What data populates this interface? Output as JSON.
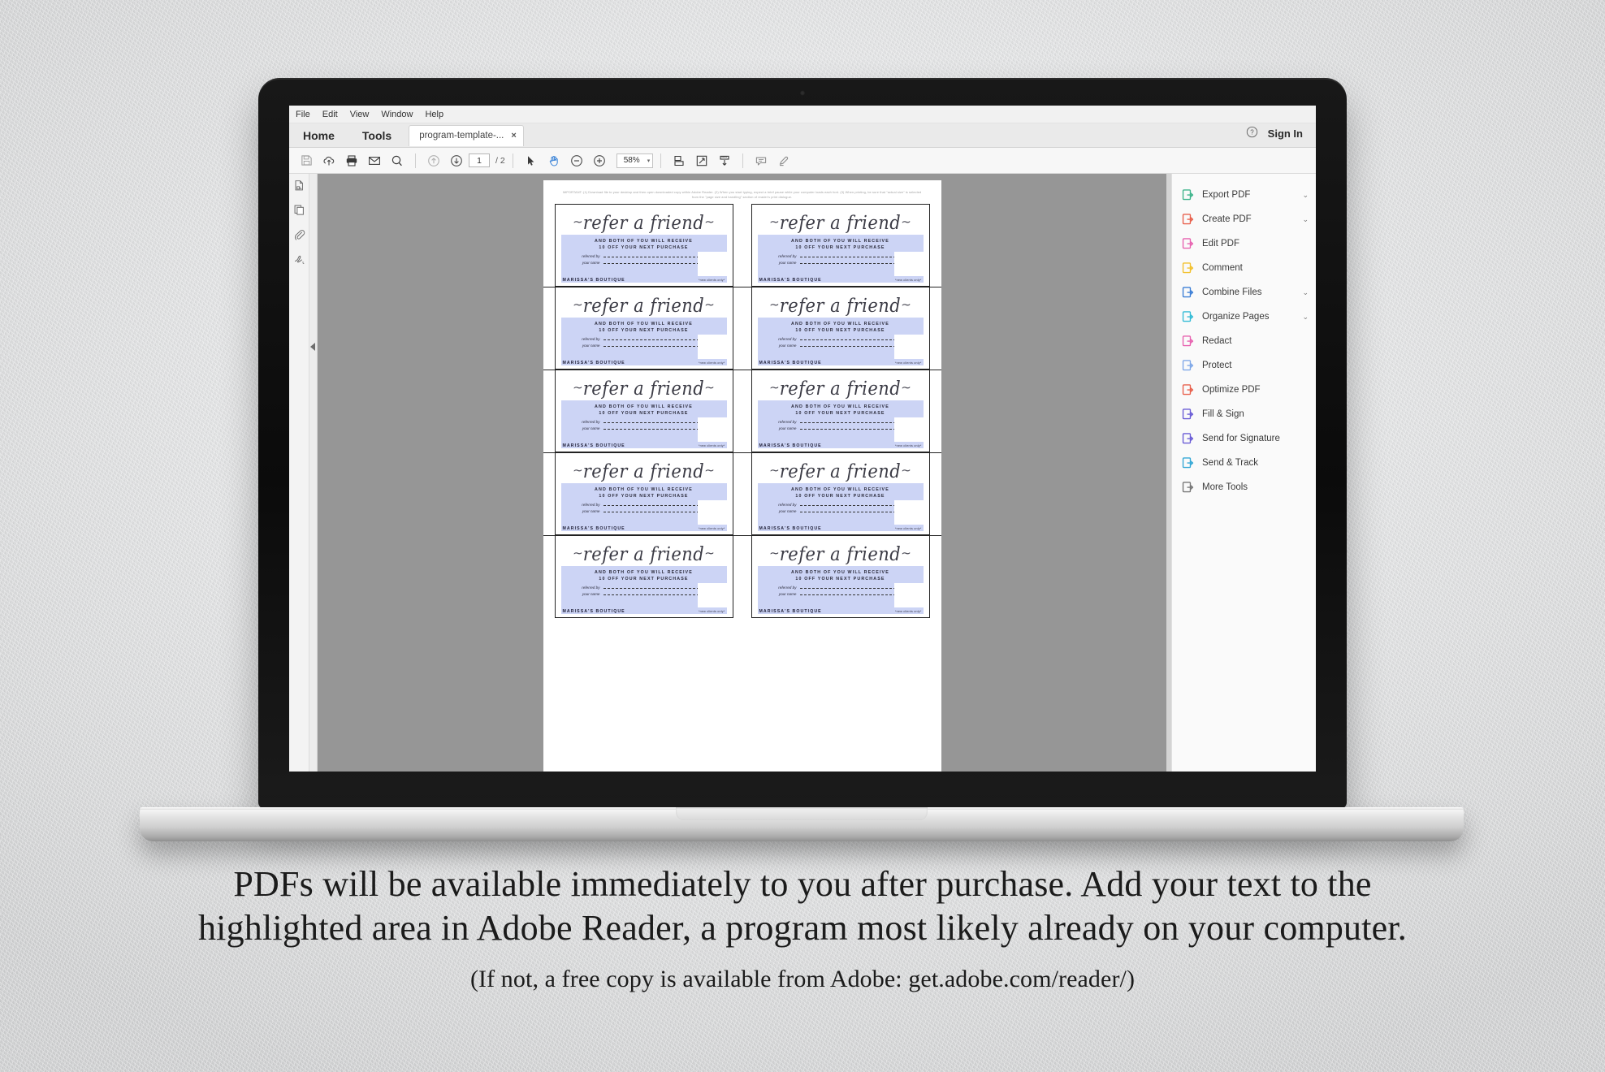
{
  "app": {
    "menubar": [
      "File",
      "Edit",
      "View",
      "Window",
      "Help"
    ],
    "home_label": "Home",
    "tools_label": "Tools",
    "doc_tab_title": "program-template-...",
    "doc_tab_close": "×",
    "help_icon": "help-circle-icon",
    "sign_in_label": "Sign In"
  },
  "toolbar": {
    "icons_left": [
      "save-icon",
      "upload-cloud-icon",
      "print-icon",
      "email-icon",
      "search-icon"
    ],
    "nav_icons": [
      "page-up-icon",
      "page-down-icon"
    ],
    "page_current": "1",
    "page_total": "/ 2",
    "cursor_icons": [
      "select-tool-icon",
      "hand-tool-icon"
    ],
    "zoom_out_icon": "zoom-out-icon",
    "zoom_in_icon": "zoom-in-icon",
    "zoom_value": "58%",
    "zoom_caret": "▾",
    "view_icons": [
      "fit-page-icon",
      "fit-width-icon",
      "scroll-mode-icon"
    ],
    "annot_icons": [
      "comment-icon",
      "highlighter-icon"
    ]
  },
  "left_rail": {
    "items": [
      {
        "icon": "page-thumbnails-icon"
      },
      {
        "icon": "pages-copy-icon"
      },
      {
        "icon": "attachments-paperclip-icon"
      },
      {
        "icon": "signature-icon"
      }
    ],
    "collapse_icon": "collapse-left-arrow-icon"
  },
  "right_panel": {
    "tools": [
      {
        "label": "Export PDF",
        "icon": "export-pdf-icon",
        "color": "#3eb48c",
        "caret": "⌄"
      },
      {
        "label": "Create PDF",
        "icon": "create-pdf-icon",
        "color": "#e8614d",
        "caret": "⌄"
      },
      {
        "label": "Edit PDF",
        "icon": "edit-pdf-icon",
        "color": "#e763b0",
        "caret": ""
      },
      {
        "label": "Comment",
        "icon": "comment-icon",
        "color": "#f2c12e",
        "caret": ""
      },
      {
        "label": "Combine Files",
        "icon": "combine-files-icon",
        "color": "#3d7fd6",
        "caret": "⌄"
      },
      {
        "label": "Organize Pages",
        "icon": "organize-pages-icon",
        "color": "#34bcd6",
        "caret": "⌄"
      },
      {
        "label": "Redact",
        "icon": "redact-icon",
        "color": "#e763b0",
        "caret": ""
      },
      {
        "label": "Protect",
        "icon": "protect-shield-icon",
        "color": "#7fa8e8",
        "caret": ""
      },
      {
        "label": "Optimize PDF",
        "icon": "optimize-pdf-icon",
        "color": "#e8614d",
        "caret": ""
      },
      {
        "label": "Fill & Sign",
        "icon": "fill-and-sign-icon",
        "color": "#6a5cd6",
        "caret": ""
      },
      {
        "label": "Send for Signature",
        "icon": "send-for-signature-icon",
        "color": "#6a5cd6",
        "caret": ""
      },
      {
        "label": "Send & Track",
        "icon": "send-and-track-icon",
        "color": "#34a8d6",
        "caret": ""
      },
      {
        "label": "More Tools",
        "icon": "more-tools-plus-icon",
        "color": "#777777",
        "caret": ""
      }
    ]
  },
  "document": {
    "note": "IMPORTANT: (1) Download file to your desktop and then open downloaded copy within Adobe Reader. (2) When you start typing, expect a brief pause while your computer loads each font. (3) When printing, be sure that \"actual size\" is selected from the \"page size and handling\" section of reader's print dialogue.",
    "card": {
      "heading": "refer a friend",
      "line1": "AND BOTH OF YOU WILL RECEIVE",
      "line2": "10 OFF YOUR NEXT PURCHASE",
      "field1_label": "referred by",
      "field2_label": "your name",
      "brand": "MARISSA'S BOUTIQUE",
      "fineprint": "*new clients only*"
    },
    "card_count": 10,
    "rows": 5,
    "columns": 2
  },
  "caption": {
    "line1": "PDFs will be available immediately to you after purchase.  Add your text to the",
    "line2": "highlighted area in Adobe Reader, a program most likely already on your computer.",
    "line3": "(If not, a free copy is available from Adobe: get.adobe.com/reader/)"
  },
  "colors": {
    "highlight_field": "#ccd4f5",
    "doc_background": "#969696",
    "panel_background": "#fafafa",
    "hand_tool_active": "#3b84d8"
  }
}
